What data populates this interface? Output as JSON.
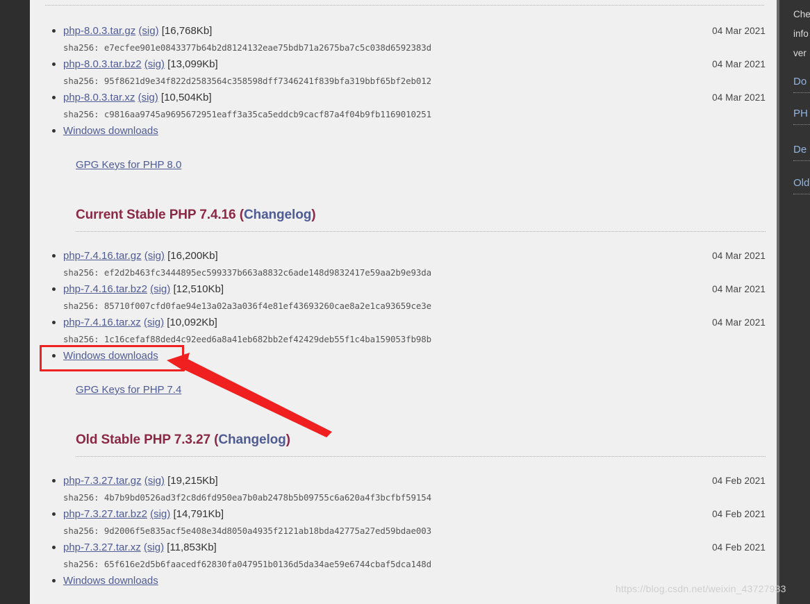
{
  "page": {
    "watermark": "https://blog.csdn.net/weixin_43727933",
    "accent_heading_color": "#8a2846",
    "link_color": "#4f5b93",
    "annotation_color": "#f02020"
  },
  "sections": [
    {
      "id": "php80",
      "heading_prefix": "",
      "heading": "",
      "changelog_label": "",
      "downloads": [
        {
          "file": "php-8.0.3.tar.gz",
          "sig": "(sig)",
          "size": "[16,768Kb]",
          "date": "04 Mar 2021",
          "sha_label": "sha256:",
          "sha": "e7ecfee901e0843377b64b2d8124132eae75bdb71a2675ba7c5c038d6592383d"
        },
        {
          "file": "php-8.0.3.tar.bz2",
          "sig": "(sig)",
          "size": "[13,099Kb]",
          "date": "04 Mar 2021",
          "sha_label": "sha256:",
          "sha": "95f8621d9e34f822d2583564c358598dff7346241f839bfa319bbf65bf2eb012"
        },
        {
          "file": "php-8.0.3.tar.xz",
          "sig": "(sig)",
          "size": "[10,504Kb]",
          "date": "04 Mar 2021",
          "sha_label": "sha256:",
          "sha": "c9816aa9745a9695672951eaff3a35ca5eddcb9cacf87a4f04b9fb1169010251"
        }
      ],
      "windows_downloads": "Windows downloads",
      "gpg": "GPG Keys for PHP 8.0"
    },
    {
      "id": "php74",
      "heading_prefix": "Current Stable PHP 7.4.16 (",
      "changelog_label": "Changelog",
      "heading_suffix": ")",
      "downloads": [
        {
          "file": "php-7.4.16.tar.gz",
          "sig": "(sig)",
          "size": "[16,200Kb]",
          "date": "04 Mar 2021",
          "sha_label": "sha256:",
          "sha": "ef2d2b463fc3444895ec599337b663a8832c6ade148d9832417e59aa2b9e93da"
        },
        {
          "file": "php-7.4.16.tar.bz2",
          "sig": "(sig)",
          "size": "[12,510Kb]",
          "date": "04 Mar 2021",
          "sha_label": "sha256:",
          "sha": "85710f007cfd0fae94e13a02a3a036f4e81ef43693260cae8a2e1ca93659ce3e"
        },
        {
          "file": "php-7.4.16.tar.xz",
          "sig": "(sig)",
          "size": "[10,092Kb]",
          "date": "04 Mar 2021",
          "sha_label": "sha256:",
          "sha": "1c16cefaf88ded4c92eed6a8a41eb682bb2ef42429deb55f1c4ba159053fb98b"
        }
      ],
      "windows_downloads": "Windows downloads",
      "gpg": "GPG Keys for PHP 7.4"
    },
    {
      "id": "php73",
      "heading_prefix": "Old Stable PHP 7.3.27 (",
      "changelog_label": "Changelog",
      "heading_suffix": ")",
      "downloads": [
        {
          "file": "php-7.3.27.tar.gz",
          "sig": "(sig)",
          "size": "[19,215Kb]",
          "date": "04 Feb 2021",
          "sha_label": "sha256:",
          "sha": "4b7b9bd0526ad3f2c8d6fd950ea7b0ab2478b5b09755c6a620a4f3bcfbf59154"
        },
        {
          "file": "php-7.3.27.tar.bz2",
          "sig": "(sig)",
          "size": "[14,791Kb]",
          "date": "04 Feb 2021",
          "sha_label": "sha256:",
          "sha": "9d2006f5e835acf5e408e34d8050a4935f2121ab18bda42775a27ed59bdae003"
        },
        {
          "file": "php-7.3.27.tar.xz",
          "sig": "(sig)",
          "size": "[11,853Kb]",
          "date": "04 Feb 2021",
          "sha_label": "sha256:",
          "sha": "65f616e2d5b6faacedf62830fa047951b0136d5da34ae59e6744cbaf5dca148d"
        }
      ],
      "windows_downloads": "Windows downloads",
      "gpg": ""
    }
  ],
  "right_sidebar": {
    "paragraph_lines": [
      "Che",
      "info",
      "ver"
    ],
    "links": [
      "Do",
      "PH",
      "De",
      "Old"
    ]
  }
}
